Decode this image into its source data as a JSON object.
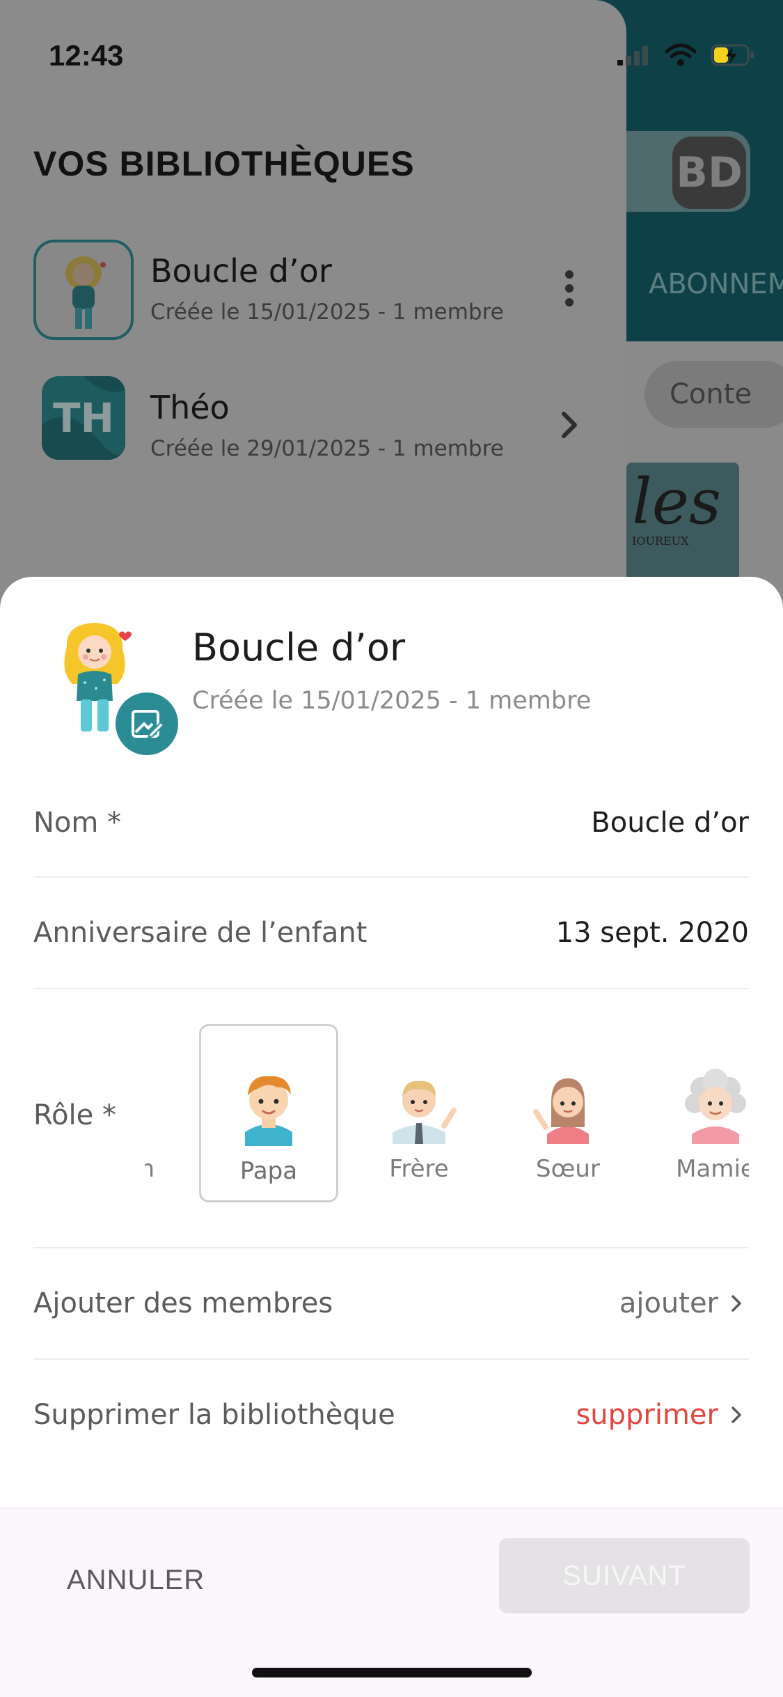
{
  "status_bar": {
    "time": "12:43"
  },
  "background": {
    "avatar_initials": "BD",
    "tab_label": "ABONNEM",
    "chip_label": "Conte",
    "book_title": "les",
    "book_sub": "IOUREUX"
  },
  "drawer": {
    "title": "VOS BIBLIOTHÈQUES",
    "libraries": [
      {
        "name": "Boucle d’or",
        "meta": "Créée le 15/01/2025 - 1 membre",
        "action": "more-vertical-icon"
      },
      {
        "name": "Théo",
        "initials": "TH",
        "meta": "Créée le 29/01/2025 - 1 membre",
        "action": "chevron-right-icon"
      }
    ]
  },
  "sheet": {
    "name": "Boucle d’or",
    "meta": "Créée le 15/01/2025 - 1 membre",
    "fields": {
      "name_label": "Nom *",
      "name_value": "Boucle d’or",
      "birthday_label": "Anniversaire de l’enfant",
      "birthday_value": "13 sept. 2020",
      "role_label": "Rôle *"
    },
    "roles": [
      {
        "label": "n",
        "partial": true
      },
      {
        "label": "Papa",
        "selected": true
      },
      {
        "label": "Frère"
      },
      {
        "label": "Sœur"
      },
      {
        "label": "Mamie"
      }
    ],
    "add_members": {
      "label": "Ajouter des membres",
      "action": "ajouter"
    },
    "delete_library": {
      "label": "Supprimer la bibliothèque",
      "action": "supprimer",
      "color": "#e4453d"
    }
  },
  "footer": {
    "cancel": "ANNULER",
    "next": "SUIVANT"
  },
  "colors": {
    "accent": "#2b8c96",
    "danger": "#e4453d"
  }
}
